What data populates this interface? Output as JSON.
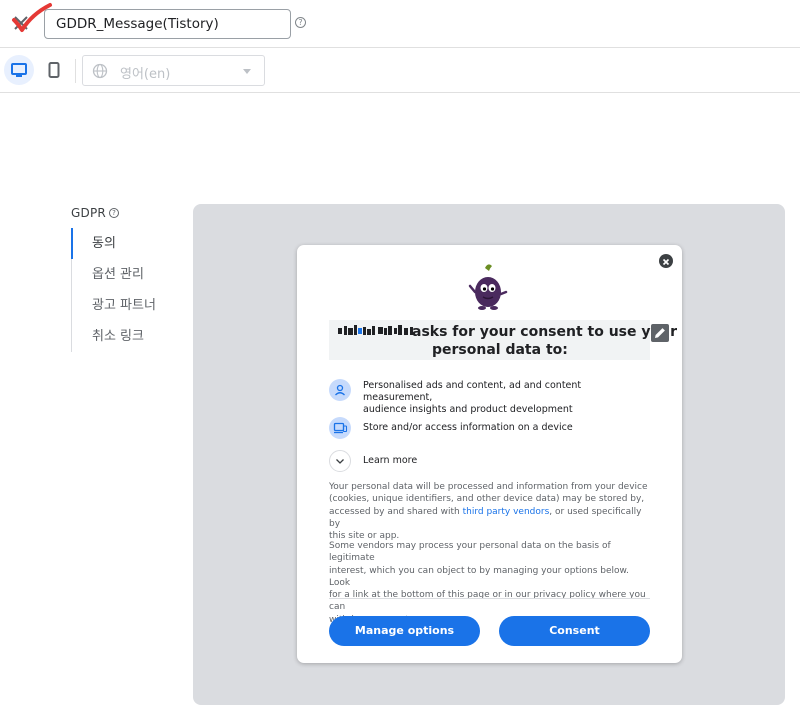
{
  "header": {
    "message_name": "GDDR_Message(Tistory)",
    "help_glyph": "?"
  },
  "toolbar": {
    "language_value": "영어(en)"
  },
  "nav": {
    "title": "GDPR",
    "help_glyph": "?",
    "items": [
      {
        "label": "동의",
        "active": true
      },
      {
        "label": "옵션 관리",
        "active": false
      },
      {
        "label": "광고 파트너",
        "active": false
      },
      {
        "label": "취소 링크",
        "active": false
      }
    ]
  },
  "dialog": {
    "headline_line1": "asks for your consent to use your",
    "headline_line2": "personal data to:",
    "purposes": [
      {
        "icon": "person-icon",
        "text_line1": "Personalised ads and content, ad and content measurement,",
        "text_line2": "audience insights and product development"
      },
      {
        "icon": "device-icon",
        "text_line1": "Store and/or access information on a device",
        "text_line2": ""
      },
      {
        "icon": "chevron-down-icon",
        "text_line1": "Learn more",
        "text_line2": ""
      }
    ],
    "legal1": {
      "line1": "Your personal data will be processed and information from your device",
      "line2": "(cookies, unique identifiers, and other device data) may be stored by,",
      "line3_before": "accessed by and shared with ",
      "line3_link": "third party vendors",
      "line3_after": ", or used specifically by",
      "line4": "this site or app."
    },
    "legal2": {
      "line1": "Some vendors may process your personal data on the basis of legitimate",
      "line2": "interest, which you can object to by managing your options below. Look",
      "line3": "for a link at the bottom of this page or in our privacy policy where you can",
      "line4": "withdraw consent."
    },
    "manage_label": "Manage options",
    "consent_label": "Consent"
  },
  "colors": {
    "accent": "#1a73e8",
    "preview_bg": "#dadce0",
    "annotation_check": "#e53935"
  }
}
